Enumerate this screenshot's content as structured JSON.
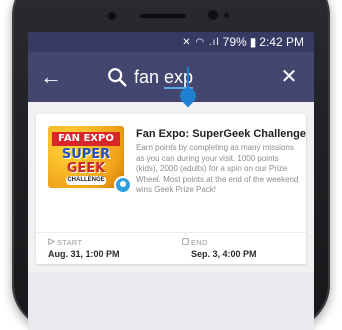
{
  "status_bar": {
    "icons": "✕ ◠ .ıl",
    "battery_percent": "79%",
    "time": "2:42 PM"
  },
  "app_bar": {
    "search_query_before_cursor": "fan ",
    "search_query_underlined": "exp"
  },
  "result": {
    "title": "Fan Expo: SuperGeek Challenge",
    "description": "Earn points by completing as many missions as you can during your visit. 1000 points (kids), 2000 (adults) for a spin on our Prize Wheel. Most points at the end of the weekend wins Geek Prize Pack!",
    "thumbnail": {
      "line1": "FAN EXPO",
      "line2": "SUPER",
      "line3": "GEEK",
      "line4": "CHALLENGE"
    },
    "start_label": "START",
    "start_value": "Aug. 31, 1:00 PM",
    "end_label": "END",
    "end_value": "Sep. 3, 4:00 PM"
  },
  "colors": {
    "app_bar": "#43466e",
    "status_bar": "#373a63",
    "cursor": "#1f7fd1"
  }
}
